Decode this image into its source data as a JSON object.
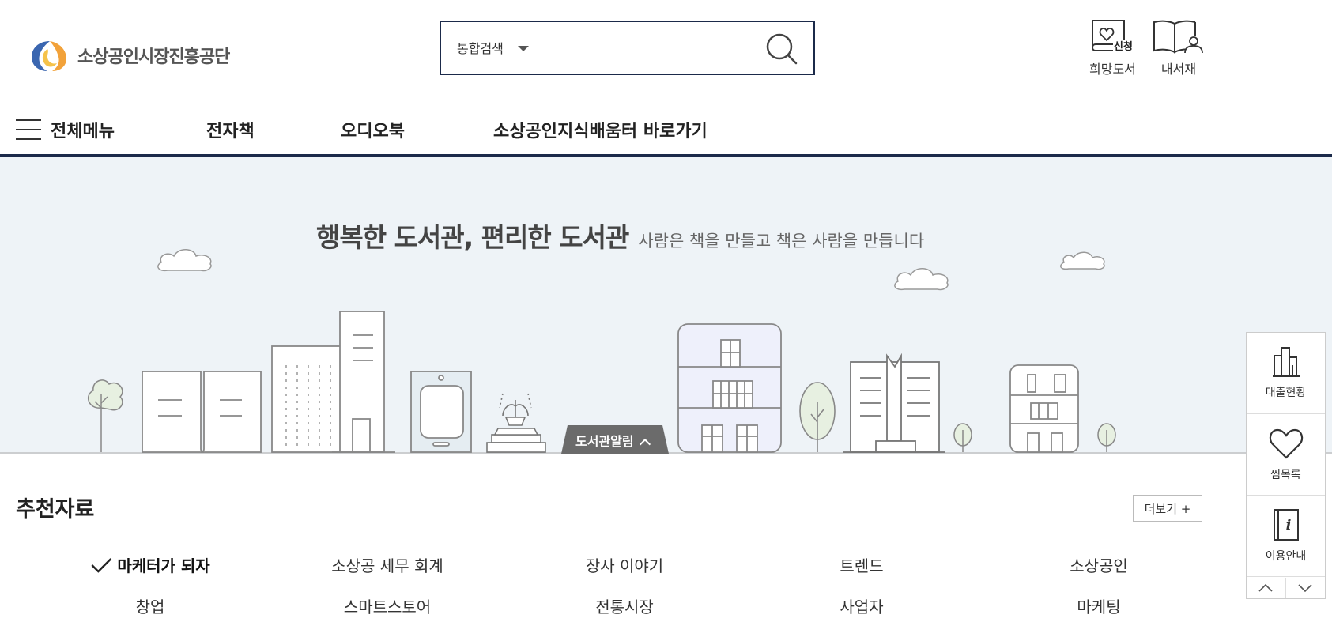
{
  "header": {
    "logo_text": "소상공인시장진흥공단",
    "search": {
      "scope": "통합검색",
      "placeholder": "",
      "value": ""
    },
    "utils": [
      {
        "label": "희망도서",
        "badge": "신청",
        "icon": "wish-book-icon"
      },
      {
        "label": "내서재",
        "icon": "my-library-icon"
      }
    ]
  },
  "nav": {
    "all_menu": "전체메뉴",
    "items": [
      "전자책",
      "오디오북",
      "소상공인지식배움터 바로가기"
    ]
  },
  "hero": {
    "title": "행복한 도서관, 편리한 도서관",
    "subtitle": "사람은 책을 만들고 책은 사람을 만듭니다",
    "notice_tab": "도서관알림"
  },
  "recommended": {
    "title": "추천자료",
    "more": "더보기 +",
    "keywords": [
      {
        "label": "마케터가 되자",
        "active": true
      },
      {
        "label": "소상공 세무 회계",
        "active": false
      },
      {
        "label": "장사 이야기",
        "active": false
      },
      {
        "label": "트렌드",
        "active": false
      },
      {
        "label": "소상공인",
        "active": false
      },
      {
        "label": "창업",
        "active": false
      },
      {
        "label": "스마트스토어",
        "active": false
      },
      {
        "label": "전통시장",
        "active": false
      },
      {
        "label": "사업자",
        "active": false
      },
      {
        "label": "마케팅",
        "active": false
      }
    ]
  },
  "quick": {
    "items": [
      {
        "label": "대출현황",
        "icon": "loan-status-icon"
      },
      {
        "label": "찜목록",
        "icon": "heart-icon"
      },
      {
        "label": "이용안내",
        "icon": "info-book-icon"
      }
    ]
  },
  "colors": {
    "navy": "#1b2a4a",
    "hero_bg": "#eef3f7",
    "notice_tab": "#6b6b6b",
    "logo_orange": "#f2a23a",
    "logo_blue": "#3a66b0"
  }
}
